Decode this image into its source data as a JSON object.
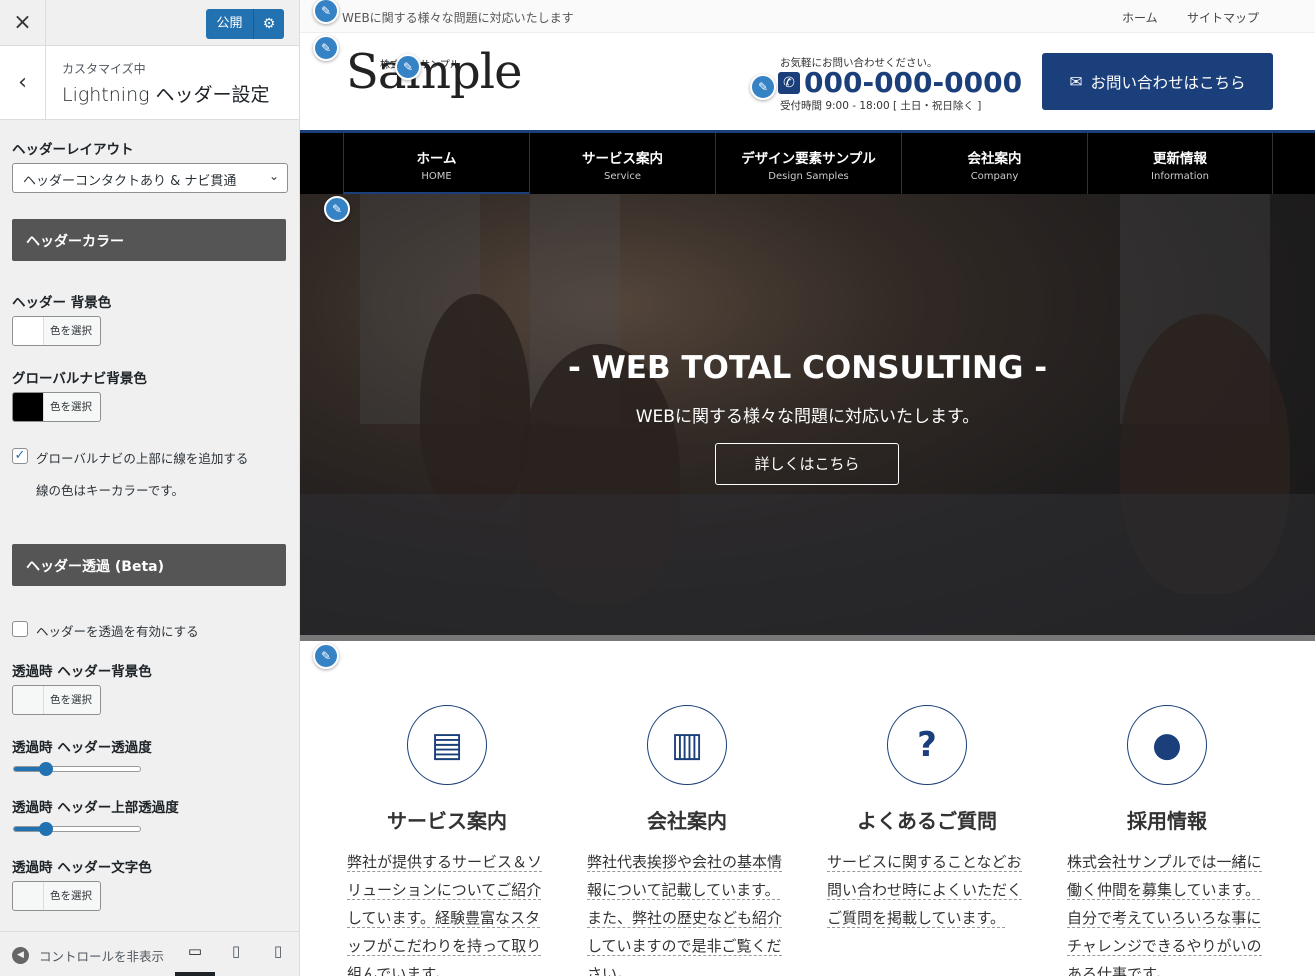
{
  "sidebar": {
    "close_icon": "×",
    "publish_label": "公開",
    "publish_gear": "⚙",
    "back_icon": "‹",
    "breadcrumb": "カスタマイズ中",
    "title": "Lightning ヘッダー設定",
    "header_layout_label": "ヘッダーレイアウト",
    "header_layout_value": "ヘッダーコンタクトあり & ナビ貫通",
    "header_color_section": "ヘッダーカラー",
    "header_bg_label": "ヘッダー 背景色",
    "gnav_bg_label": "グローバルナビ背景色",
    "color_select_label": "色を選択",
    "gnav_border_check_label": "グローバルナビの上部に線を追加する",
    "gnav_border_note": "線の色はキーカラーです。",
    "transparent_section": "ヘッダー透過 (Beta)",
    "transparent_enable_label": "ヘッダーを透過を有効にする",
    "trans_bg_label": "透過時 ヘッダー背景色",
    "trans_opacity_label": "透過時 ヘッダー透過度",
    "trans_top_opacity_label": "透過時 ヘッダー上部透過度",
    "trans_text_color_label": "透過時 ヘッダー文字色",
    "trans_opacity_value": 0.25,
    "trans_top_opacity_value": 0.25,
    "hide_controls_label": "コントロールを非表示",
    "colors": {
      "header_bg": "#ffffff",
      "gnav_bg": "#000000",
      "accent": "#2271b1"
    }
  },
  "preview": {
    "tagline": "WEBに関する様々な問題に対応いたします",
    "util_links": [
      "ホーム",
      "サイトマップ"
    ],
    "logo_text": "Sample",
    "logo_small_left": "株式",
    "logo_small_right": "サンプル",
    "contact_lead": "お気軽にお問い合わせください。",
    "phone": "000-000-0000",
    "hours": "受付時間 9:00 - 18:00 [ 土日・祝日除く ]",
    "contact_button": "お問い合わせはこちら",
    "nav": [
      {
        "jp": "ホーム",
        "en": "HOME"
      },
      {
        "jp": "サービス案内",
        "en": "Service"
      },
      {
        "jp": "デザイン要素サンプル",
        "en": "Design Samples"
      },
      {
        "jp": "会社案内",
        "en": "Company"
      },
      {
        "jp": "更新情報",
        "en": "Information"
      }
    ],
    "hero": {
      "title": "- WEB TOTAL CONSULTING -",
      "subtitle": "WEBに関する様々な問題に対応いたします。",
      "button": "詳しくはこちら"
    },
    "pr": [
      {
        "icon": "document-icon",
        "glyph": "▤",
        "title": "サービス案内",
        "lines": [
          "弊社が提供するサービス＆ソ",
          "リューションについてご紹介",
          "しています。経験豊富なスタ",
          "ッフがこだわりを持って取り",
          "組んでいます。"
        ]
      },
      {
        "icon": "building-icon",
        "glyph": "▥",
        "title": "会社案内",
        "lines": [
          "弊社代表挨拶や会社の基本情",
          "報について記載しています。",
          "また、弊社の歴史なども紹介",
          "していますので是非ご覧くだ",
          "さい。"
        ]
      },
      {
        "icon": "question-icon",
        "glyph": "?",
        "title": "よくあるご質問",
        "lines": [
          "サービスに関することなどお",
          "問い合わせ時によくいただく",
          "ご質問を掲載しています。"
        ]
      },
      {
        "icon": "user-icon",
        "glyph": "●",
        "title": "採用情報",
        "lines": [
          "株式会社サンプルでは一緒に",
          "働く仲間を募集しています。",
          "自分で考えていろいろな事に",
          "チャレンジできるやりがいの",
          "ある仕事です。"
        ]
      }
    ],
    "colors": {
      "key": "#1a3f7a"
    }
  }
}
